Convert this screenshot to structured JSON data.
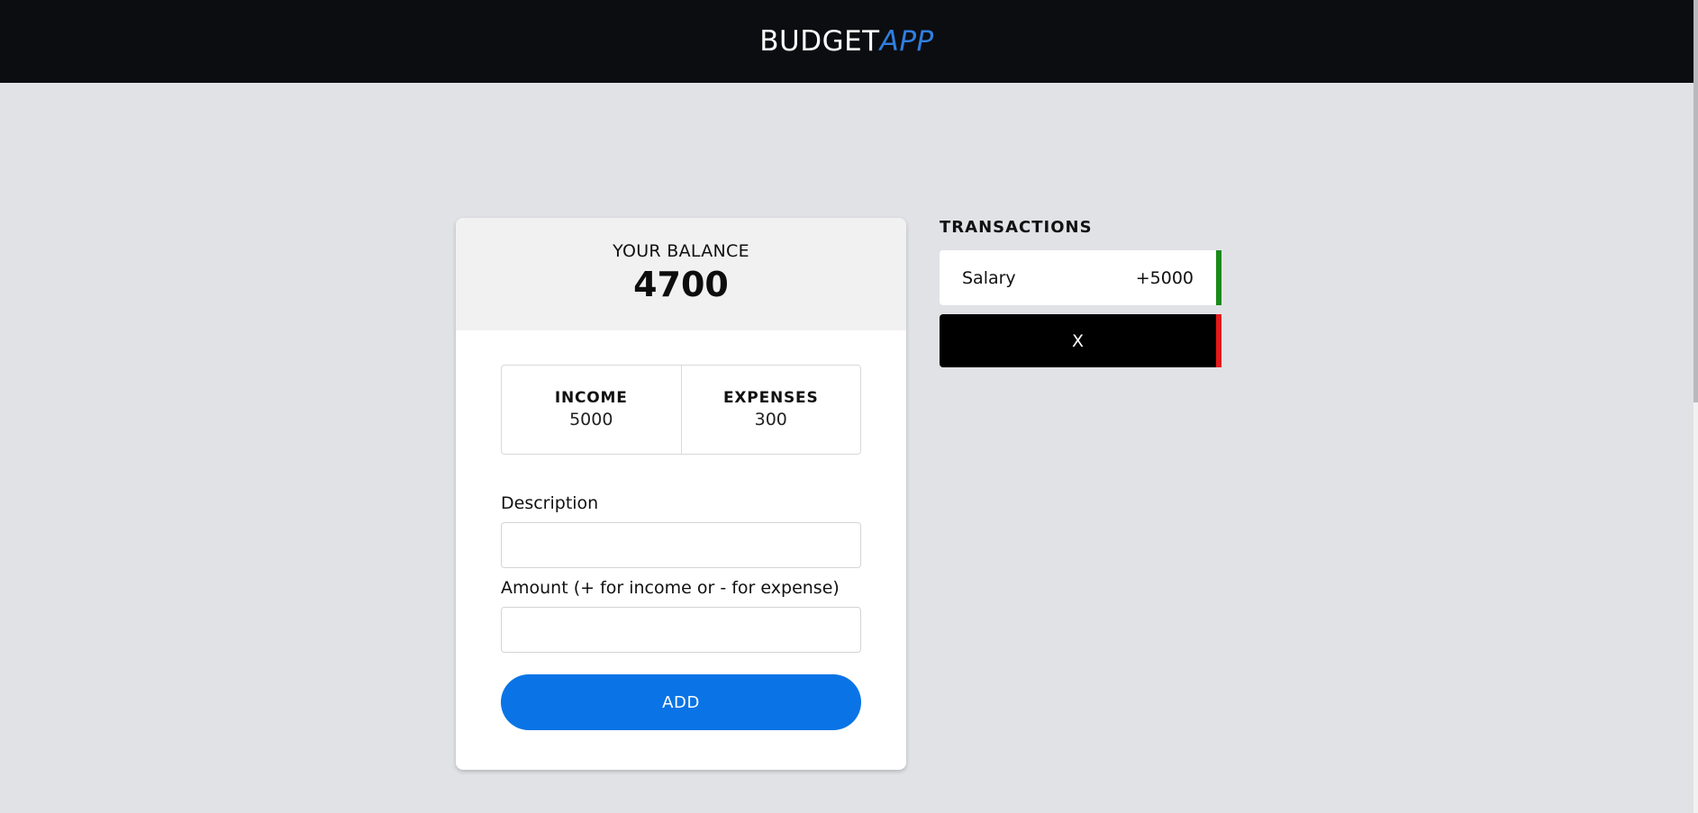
{
  "header": {
    "brand_main": "BUDGET",
    "brand_accent": "APP"
  },
  "balance": {
    "label": "YOUR BALANCE",
    "value": "4700"
  },
  "summary": {
    "income_label": "INCOME",
    "income_value": "5000",
    "expenses_label": "EXPENSES",
    "expenses_value": "300"
  },
  "form": {
    "description_label": "Description",
    "description_value": "",
    "amount_label": "Amount (+ for income or - for expense)",
    "amount_value": "",
    "add_label": "ADD"
  },
  "transactions": {
    "heading": "TRANSACTIONS",
    "items": [
      {
        "description": "Salary",
        "amount": "+5000",
        "kind": "income"
      },
      {
        "delete_label": "X",
        "kind": "expense"
      }
    ]
  },
  "colors": {
    "header_bg": "#0c0d11",
    "brand_accent": "#2f7fe0",
    "page_bg": "#e1e2e6",
    "primary_button": "#0a74e6",
    "income_marker": "#1a8a1a",
    "expense_marker": "#e31919"
  },
  "icons": {
    "delete_transaction": "x-icon"
  }
}
